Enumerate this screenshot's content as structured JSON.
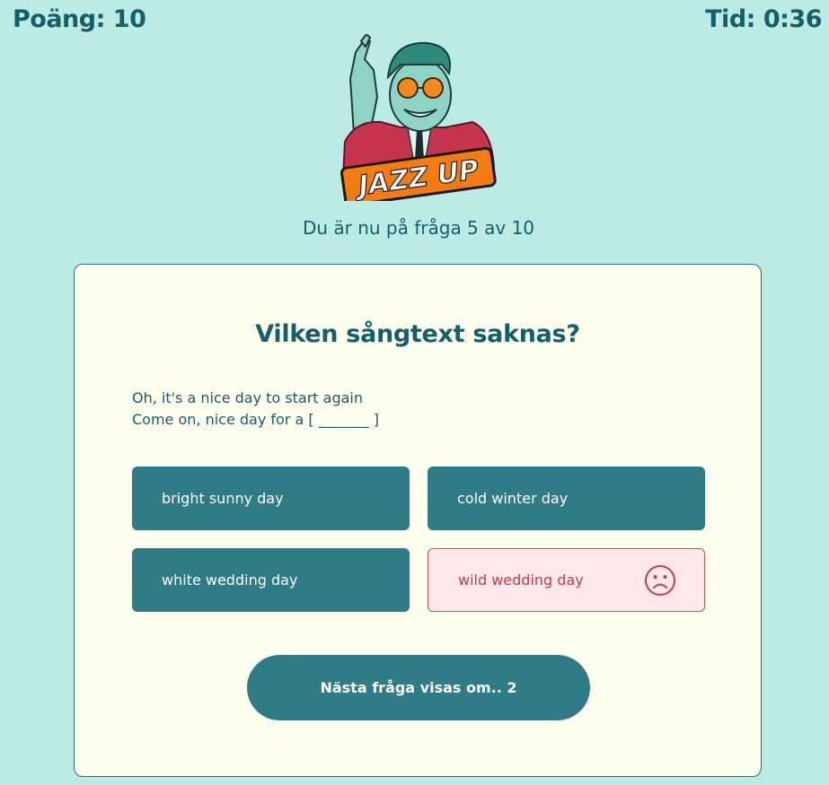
{
  "header": {
    "score_text": "Poäng: 10",
    "timer_text": "Tid: 0:36"
  },
  "logo": {
    "icon": "jazz-up-logo",
    "wordmark": "JAZZ UP"
  },
  "progress": {
    "text": "Du är nu på fråga 5 av 10"
  },
  "quiz": {
    "question": "Vilken sångtext saknas?",
    "lyrics": [
      "Oh, it's a nice day to start again",
      "Come on, nice day for a [ _______ ]"
    ],
    "answers": [
      {
        "label": "bright sunny day",
        "state": "default"
      },
      {
        "label": "cold winter day",
        "state": "default"
      },
      {
        "label": "white wedding day",
        "state": "default"
      },
      {
        "label": "wild wedding day",
        "state": "wrong",
        "icon": "sad-face-icon"
      }
    ],
    "next_label": "Nästa fråga visas om.. 2"
  },
  "colors": {
    "background": "#bcebe5",
    "card": "#fdfeed",
    "accent": "#2f7c87",
    "text": "#155e6b",
    "wrong_bg": "#fde8ea",
    "wrong_text": "#c83a46"
  }
}
